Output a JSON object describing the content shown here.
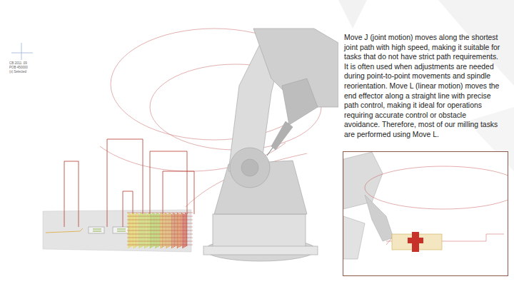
{
  "slide": {
    "readout": [
      "CB 2011 .09",
      "POB 450000",
      "(x) Selected"
    ],
    "paragraph": "Move J (joint motion) moves along the shortest joint path with high speed, making it suitable for tasks that do not have strict path requirements. It is often used when adjustments are needed during point-to-point movements and spindle reorientation. Move L (linear motion) moves the end effector along a straight line with precise path control, making it ideal for operations requiring accurate control or obstacle avoidance. Therefore, most of our milling tasks are performed using Move L."
  }
}
